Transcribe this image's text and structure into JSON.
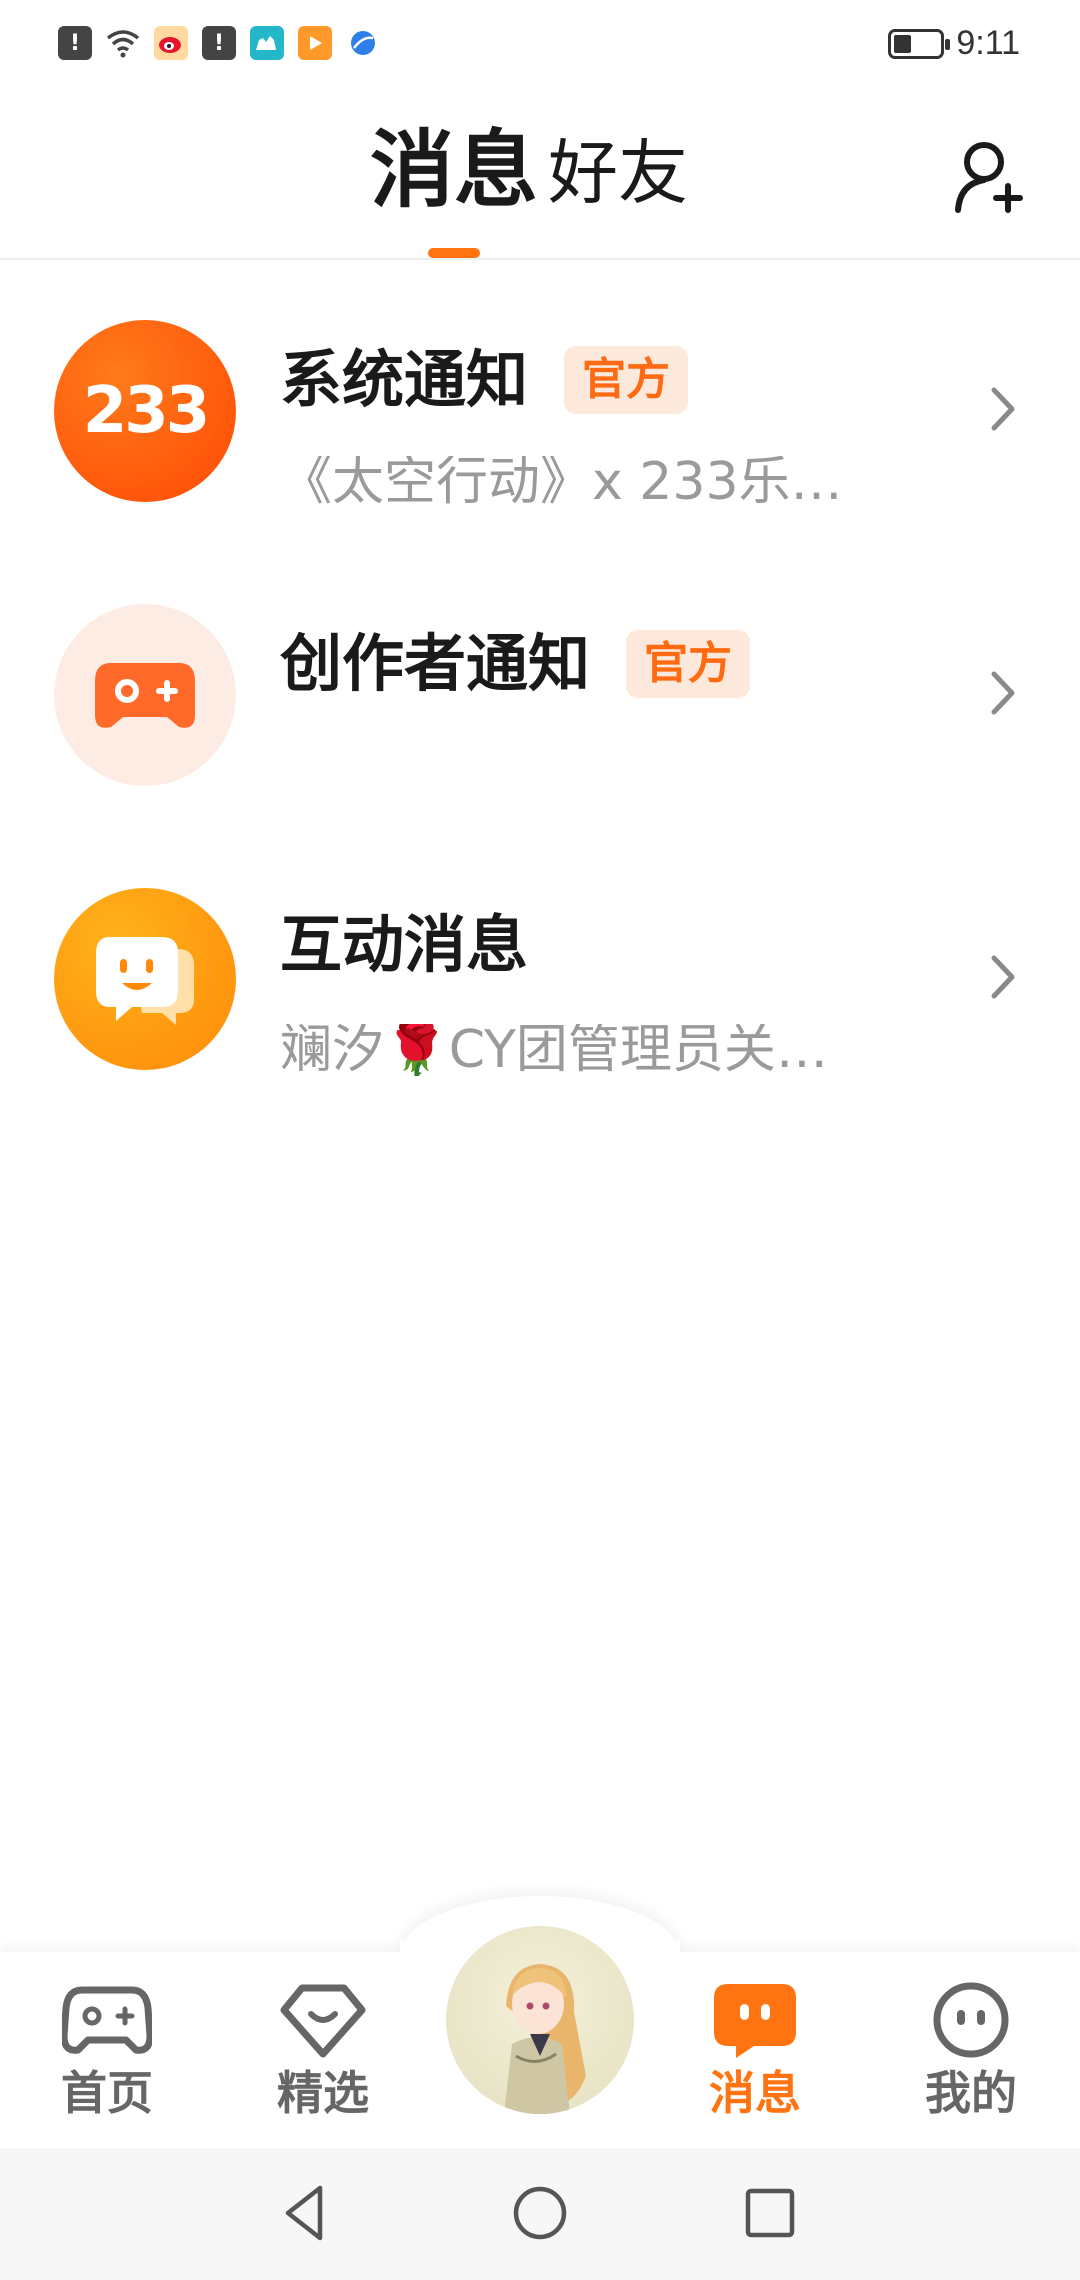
{
  "status_bar": {
    "time": "9:11",
    "battery_level": 0.45,
    "icons": [
      "alert-icon",
      "wifi-icon",
      "weibo-icon",
      "alert-icon",
      "camel-app-icon",
      "video-app-icon",
      "browser-icon"
    ]
  },
  "header": {
    "tab_messages": "消息",
    "tab_friends": "好友",
    "add_friend_icon": "add-friend-icon"
  },
  "messages": [
    {
      "title": "系统通知",
      "badge": "官方",
      "subtitle": "《太空行动》x 233乐…",
      "avatar_text": "233"
    },
    {
      "title": "创作者通知",
      "badge": "官方",
      "subtitle": ""
    },
    {
      "title": "互动消息",
      "badge": "",
      "subtitle": "斓汐🌹CY团管理员关…"
    }
  ],
  "bottom_nav": {
    "home": "首页",
    "featured": "精选",
    "messages": "消息",
    "mine": "我的",
    "active": "消息",
    "accent_color": "#ff7310"
  }
}
